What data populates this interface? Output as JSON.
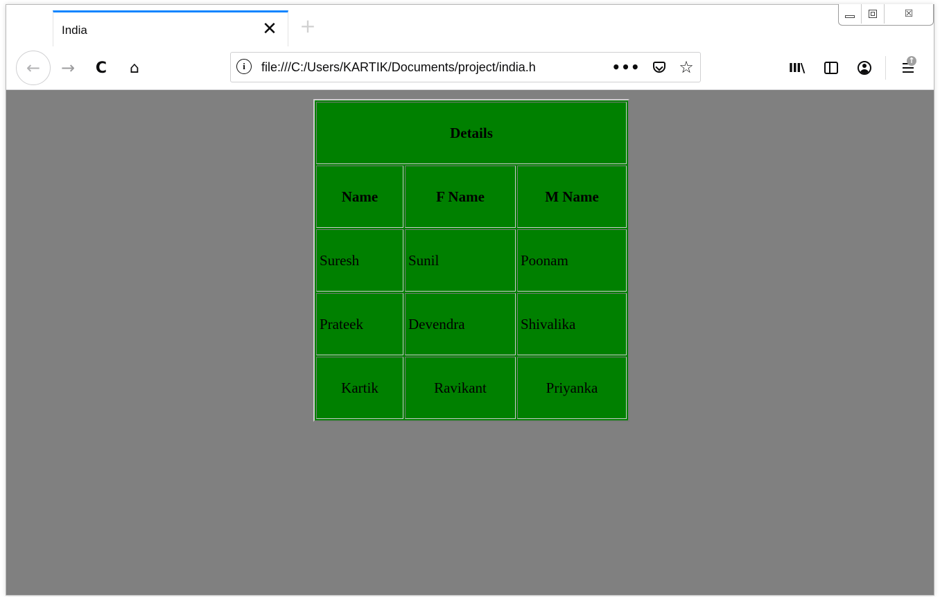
{
  "browser": {
    "tab": {
      "title": "India",
      "close_icon": "✕"
    },
    "new_tab_icon": "+",
    "url": "file:///C:/Users/KARTIK/Documents/project/india.h",
    "page_actions_glyph": "•••",
    "star_glyph": "☆",
    "library_glyph": "III\\",
    "back_glyph": "←",
    "forward_glyph": "→",
    "reload_glyph": "C",
    "home_glyph": "⌂",
    "close_glyph": "☒",
    "info_glyph": "i",
    "update_badge": "↑"
  },
  "colors": {
    "page_background": "#808080",
    "table_background": "#008000",
    "tab_accent": "#0a84ff"
  },
  "table": {
    "caption": "Details",
    "headers": [
      "Name",
      "F Name",
      "M Name"
    ],
    "rows": [
      [
        "Suresh",
        "Sunil",
        "Poonam"
      ],
      [
        "Prateek",
        "Devendra",
        "Shivalika"
      ],
      [
        "Kartik",
        "Ravikant",
        "Priyanka"
      ]
    ]
  }
}
